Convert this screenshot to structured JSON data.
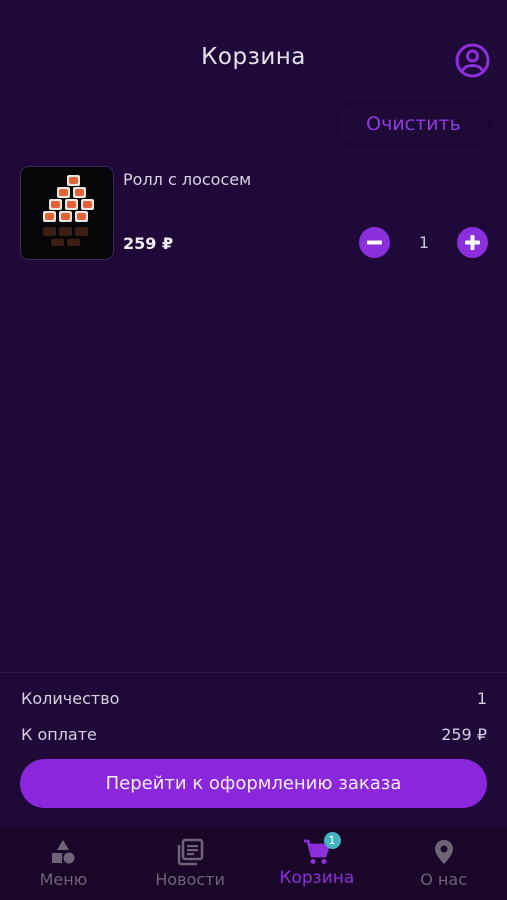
{
  "header": {
    "title": "Корзина",
    "clear_label": "Очистить",
    "profile_icon": "account-circle-icon"
  },
  "cart": {
    "items": [
      {
        "name": "Ролл с лососем",
        "price": "259 ₽",
        "quantity": "1"
      }
    ]
  },
  "summary": {
    "quantity_label": "Количество",
    "quantity_value": "1",
    "pay_label": "К оплате",
    "pay_value": "259 ₽",
    "checkout_label": "Перейти к оформлению заказа"
  },
  "nav": {
    "items": [
      {
        "label": "Меню",
        "icon": "shapes-icon"
      },
      {
        "label": "Новости",
        "icon": "newspaper-icon"
      },
      {
        "label": "Корзина",
        "icon": "cart-icon",
        "badge": "1",
        "active": true
      },
      {
        "label": "О нас",
        "icon": "location-pin-icon"
      }
    ]
  },
  "colors": {
    "background": "#1f0938",
    "accent": "#8b2edb",
    "nav_background": "#190628",
    "badge": "#45b3c0"
  }
}
